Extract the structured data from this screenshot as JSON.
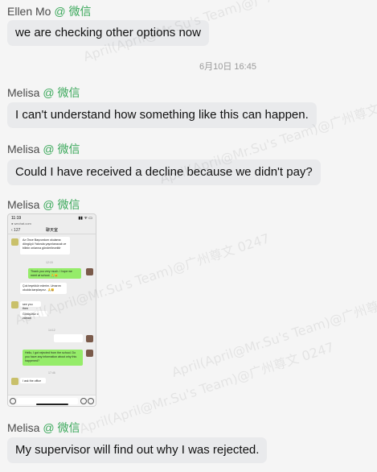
{
  "watermark_text": "April(April@Mr.Su's Team)@广州尊文 0247",
  "messages": [
    {
      "sender": "Ellen Mo",
      "tag": "@ 微信",
      "text": "we are checking other options now"
    },
    {
      "sender": "Melisa",
      "tag": "@ 微信",
      "text": "I can't understand how something like this can happen."
    },
    {
      "sender": "Melisa",
      "tag": "@ 微信",
      "text": "Could I have received a decline because we didn't pay?"
    },
    {
      "sender": "Melisa",
      "tag": "@ 微信"
    },
    {
      "sender": "Melisa",
      "tag": "@ 微信",
      "text": "My supervisor will find out why I was rejected."
    }
  ],
  "timestamp": "6月10日 16:45",
  "thumbnail": {
    "status_time": "11:19",
    "status_icons": "▮▮ ᯤ ▭",
    "url": "● wechat.com",
    "back": "‹ 127",
    "chat_title": "聊天室",
    "time1": "12:15",
    "time2": "14:12",
    "time3": "17:46",
    "m1": "Az Önce Başvurdum okulama döngüyü Yakında yayınlanacak ve bilinin onlarına gönderilecektir",
    "m2": "Thank you very much. I hope we meet at school. 🙏😀",
    "m3": "Çok teşekkür ederim. Umarım okulda karşılaşırız. 🙏😀",
    "m4": "see you then",
    "m5": "Görüşürüz o zaman",
    "m6": "Hello, I got rejected from the school. Do you have any information about why this happened?",
    "m7": "I ask the office"
  }
}
